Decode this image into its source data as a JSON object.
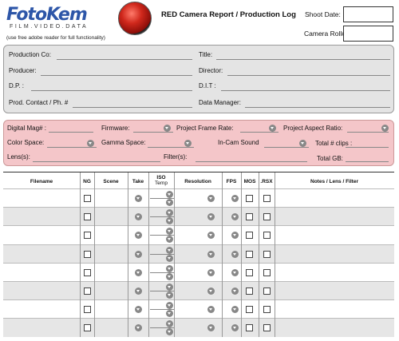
{
  "header": {
    "logo": "FotoKem",
    "tagline": "FILM.VIDEO.DATA",
    "note": "(use free adobe reader for full functionality)",
    "title": "RED Camera Report / Production Log",
    "shoot_date_label": "Shoot Date:",
    "camera_roll_label": "Camera Roll#"
  },
  "production": {
    "production_co": "Production Co:",
    "producer": "Producer:",
    "dp": "D.P. :",
    "prod_contact": "Prod. Contact / Ph. #",
    "title": "Title:",
    "director": "Director:",
    "dit": "D.I.T :",
    "data_manager": "Data Manager:"
  },
  "camera": {
    "digital_mag": "Digital Mag# :",
    "firmware": "Firmware:",
    "frame_rate": "Project Frame Rate:",
    "aspect_ratio": "Project Aspect Ratio:",
    "color_space": "Color Space:",
    "gamma_space": "Gamma Space:",
    "in_cam_sound": "In-Cam Sound",
    "total_clips": "Total # clips :",
    "lens": "Lens(s):",
    "filter": "Filter(s):",
    "total_gb": "Total GB:"
  },
  "table": {
    "columns": {
      "filename": "Filename",
      "ng": "NG",
      "scene": "Scene",
      "take": "Take",
      "iso": "ISO",
      "temp": "Temp",
      "resolution": "Resolution",
      "fps": "FPS",
      "mos": "MOS",
      "rsx": ".RSX",
      "notes": "Notes / Lens / Filter"
    },
    "row_count": 8
  },
  "colors": {
    "logo_blue": "#2d56a8",
    "panel_gray": "#e4e4e4",
    "panel_pink": "#f4c6c9",
    "row_shade": "#e6e6e6"
  },
  "icons": {
    "dropdown": "chevron-down-icon",
    "badge": "red-camera-badge"
  }
}
